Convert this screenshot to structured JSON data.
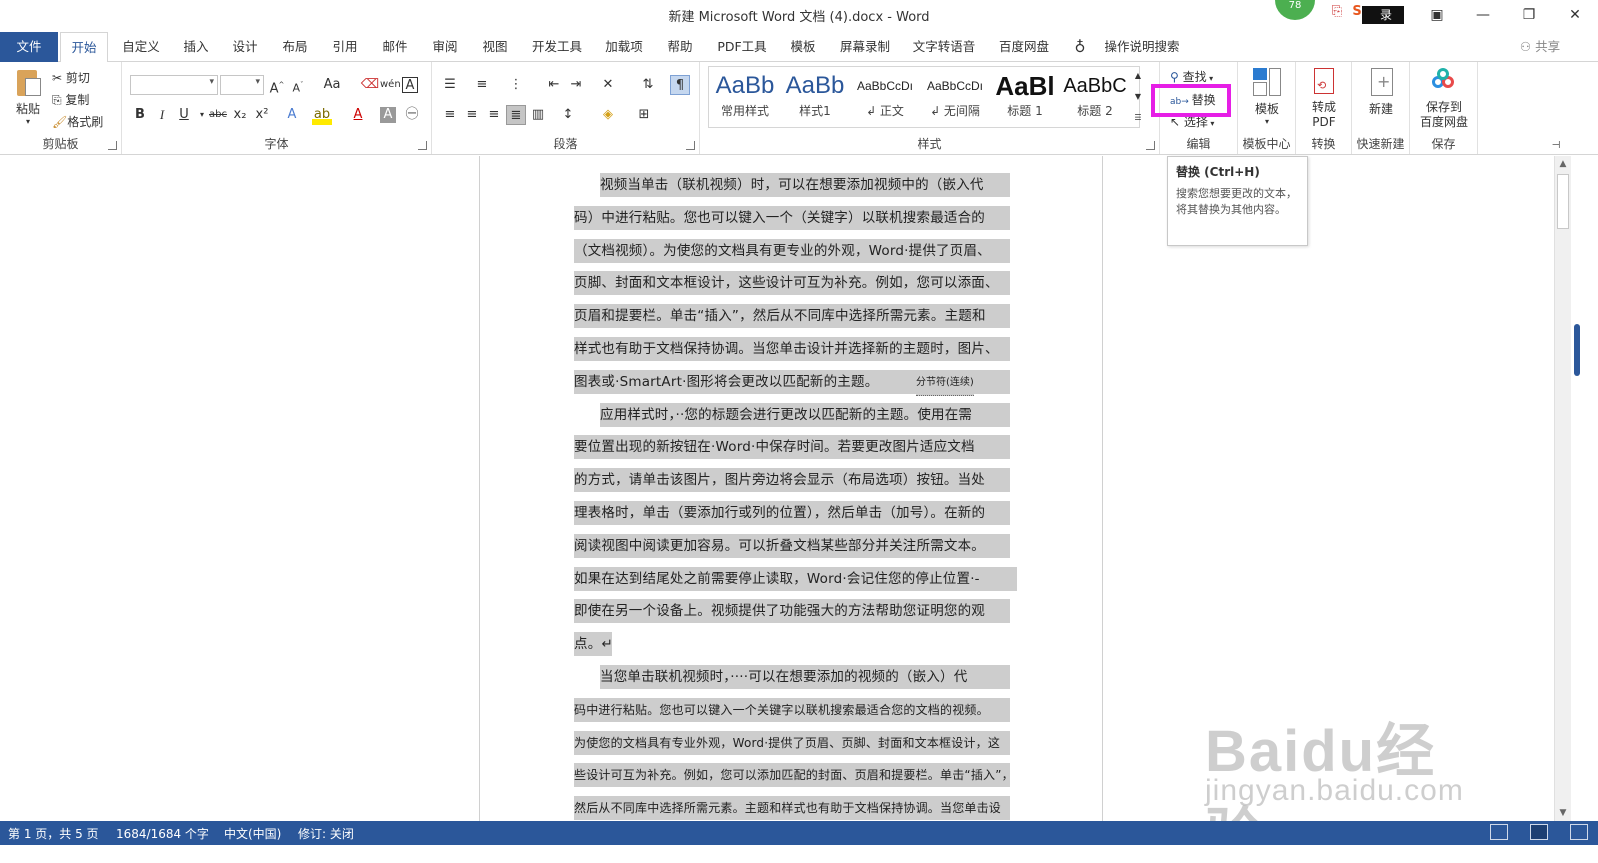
{
  "window": {
    "title": "新建 Microsoft Word 文档 (4).docx  -  Word",
    "badge": "78",
    "login_label": "录",
    "controls": [
      "ribbon-display",
      "minimize",
      "restore",
      "close"
    ]
  },
  "tabs": [
    {
      "label": "文件"
    },
    {
      "label": "开始"
    },
    {
      "label": "自定义"
    },
    {
      "label": "插入"
    },
    {
      "label": "设计"
    },
    {
      "label": "布局"
    },
    {
      "label": "引用"
    },
    {
      "label": "邮件"
    },
    {
      "label": "审阅"
    },
    {
      "label": "视图"
    },
    {
      "label": "开发工具"
    },
    {
      "label": "加载项"
    },
    {
      "label": "帮助"
    },
    {
      "label": "PDF工具"
    },
    {
      "label": "模板"
    },
    {
      "label": "屏幕录制"
    },
    {
      "label": "文字转语音"
    },
    {
      "label": "百度网盘"
    }
  ],
  "tell_me": "操作说明搜索",
  "share": "共享",
  "ribbon": {
    "clipboard": {
      "label": "剪贴板",
      "paste": "粘贴",
      "cut": "剪切",
      "copy": "复制",
      "format_painter": "格式刷"
    },
    "font": {
      "label": "字体",
      "bold": "B",
      "italic": "I",
      "underline": "U",
      "strike": "abc",
      "sub": "x₂",
      "sup": "x²",
      "change_case": "Aa"
    },
    "paragraph": {
      "label": "段落"
    },
    "styles": {
      "label": "样式",
      "items": [
        {
          "preview": "AaBb",
          "name": "常用样式"
        },
        {
          "preview": "AaBb",
          "name": "样式1"
        },
        {
          "preview": "AaBbCcDı",
          "name": "↲ 正文"
        },
        {
          "preview": "AaBbCcDı",
          "name": "↲ 无间隔"
        },
        {
          "preview": "AaBl",
          "name": "标题 1"
        },
        {
          "preview": "AaBbC",
          "name": "标题 2"
        }
      ]
    },
    "editing": {
      "label": "编辑",
      "find": "查找",
      "replace": "替换",
      "select": "选择"
    },
    "template_center": {
      "label": "模板中心",
      "button": "模板"
    },
    "convert": {
      "label": "转换",
      "button": "转成PDF",
      "button_line1": "转成",
      "button_line2": "PDF"
    },
    "quick_new": {
      "label": "快速新建",
      "button": "新建"
    },
    "save": {
      "label": "保存",
      "button_line1": "保存到",
      "button_line2": "百度网盘"
    }
  },
  "tooltip": {
    "title": "替换 (Ctrl+H)",
    "body": "搜索您想要更改的文本，将其替换为其他内容。"
  },
  "document": {
    "lines": [
      {
        "text": "视频当单击（联机视频）时，可以在想要添加视频中的（嵌入代",
        "indent": true
      },
      {
        "text": "码）中进行粘贴。您也可以键入一个（关键字）以联机搜索最适合的"
      },
      {
        "text": "（文档视频）。为使您的文档具有更专业的外观，Word·提供了页眉、"
      },
      {
        "text": "页脚、封面和文本框设计，这些设计可互为补充。例如，您可以添面、"
      },
      {
        "text": "页眉和提要栏。单击“插入”，然后从不同库中选择所需元素。主题和"
      },
      {
        "text": "样式也有助于文档保持协调。当您单击设计并选择新的主题时，图片、"
      },
      {
        "text": "图表或·SmartArt·图形将会更改以匹配新的主题。",
        "section_break": "分节符(连续)"
      },
      {
        "text": "应用样式时，··您的标题会进行更改以匹配新的主题。使用在需",
        "indent": true
      },
      {
        "text": "要位置出现的新按钮在·Word·中保存时间。若要更改图片适应文档"
      },
      {
        "text": "的方式，请单击该图片，图片旁边将会显示（布局选项）按钮。当处"
      },
      {
        "text": "理表格时，单击（要添加行或列的位置），然后单击（加号）。在新的"
      },
      {
        "text": "阅读视图中阅读更加容易。可以折叠文档某些部分并关注所需文本。"
      },
      {
        "text": "如果在达到结尾处之前需要停止读取，Word·会记住您的停止位置·-"
      },
      {
        "text": "即使在另一个设备上。视频提供了功能强大的方法帮助您证明您的观"
      },
      {
        "text": "点。↵",
        "short": true
      },
      {
        "text": "当您单击联机视频时，····可以在想要添加的视频的（嵌入）代",
        "indent": true
      },
      {
        "text": "码中进行粘贴。您也可以键入一个关键字以联机搜索最适合您的文档的视频。",
        "small": true
      },
      {
        "text": "为使您的文档具有专业外观，Word·提供了页眉、页脚、封面和文本框设计，这",
        "small": true
      },
      {
        "text": "些设计可互为补充。例如，您可以添加匹配的封面、页眉和提要栏。单击“插入”，",
        "small": true
      },
      {
        "text": "然后从不同库中选择所需元素。主题和样式也有助于文档保持协调。当您单击设",
        "small": true
      }
    ]
  },
  "watermark": {
    "brand": "Baidu经验",
    "url": "jingyan.baidu.com"
  },
  "statusbar": {
    "page": "第 1 页，共 5 页",
    "words": "1684/1684 个字",
    "language": "中文(中国)",
    "track_changes": "修订: 关闭"
  },
  "colors": {
    "accent": "#2b579a",
    "highlight": "#e61ee6",
    "selection": "#cdcdcd"
  }
}
